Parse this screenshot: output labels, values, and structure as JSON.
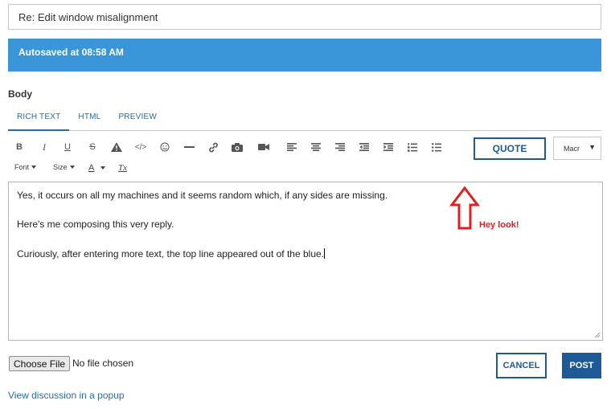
{
  "subject": {
    "value": "Re: Edit window misalignment"
  },
  "autosave": {
    "text": "Autosaved at 08:58 AM",
    "color": "#3a96d9"
  },
  "body_label": "Body",
  "tabs": [
    {
      "label": "RICH TEXT",
      "active": true
    },
    {
      "label": "HTML",
      "active": false
    },
    {
      "label": "PREVIEW",
      "active": false
    }
  ],
  "toolbar": {
    "bold": "B",
    "italic": "I",
    "underline": "U",
    "strike": "S",
    "icons": [
      "bold-icon",
      "italic-icon",
      "underline-icon",
      "strikethrough-icon",
      "warning-icon",
      "code-icon",
      "emoji-icon",
      "horizontal-rule-icon",
      "link-icon",
      "camera-icon",
      "video-icon",
      "align-left-icon",
      "align-center-icon",
      "align-right-icon",
      "outdent-icon",
      "indent-icon",
      "numbered-list-icon",
      "bulleted-list-icon"
    ],
    "quote_label": "QUOTE",
    "macro_label": "Macr",
    "font_label": "Font",
    "size_label": "Size",
    "text_color_label": "A",
    "clear_format_label": "Tx"
  },
  "editor": {
    "lines": [
      "Yes, it occurs on all my machines and it seems random which, if any sides are missing.",
      "Here's me composing this very reply.",
      "Curiously, after entering more text, the top line appeared out of the blue."
    ]
  },
  "annotation": {
    "text": "Hey look!",
    "color": "#e02020"
  },
  "file": {
    "button_label": "Choose File",
    "status": "No file chosen"
  },
  "actions": {
    "cancel_label": "CANCEL",
    "post_label": "POST",
    "accent": "#1e5a96"
  },
  "popup_link": "View discussion in a popup"
}
